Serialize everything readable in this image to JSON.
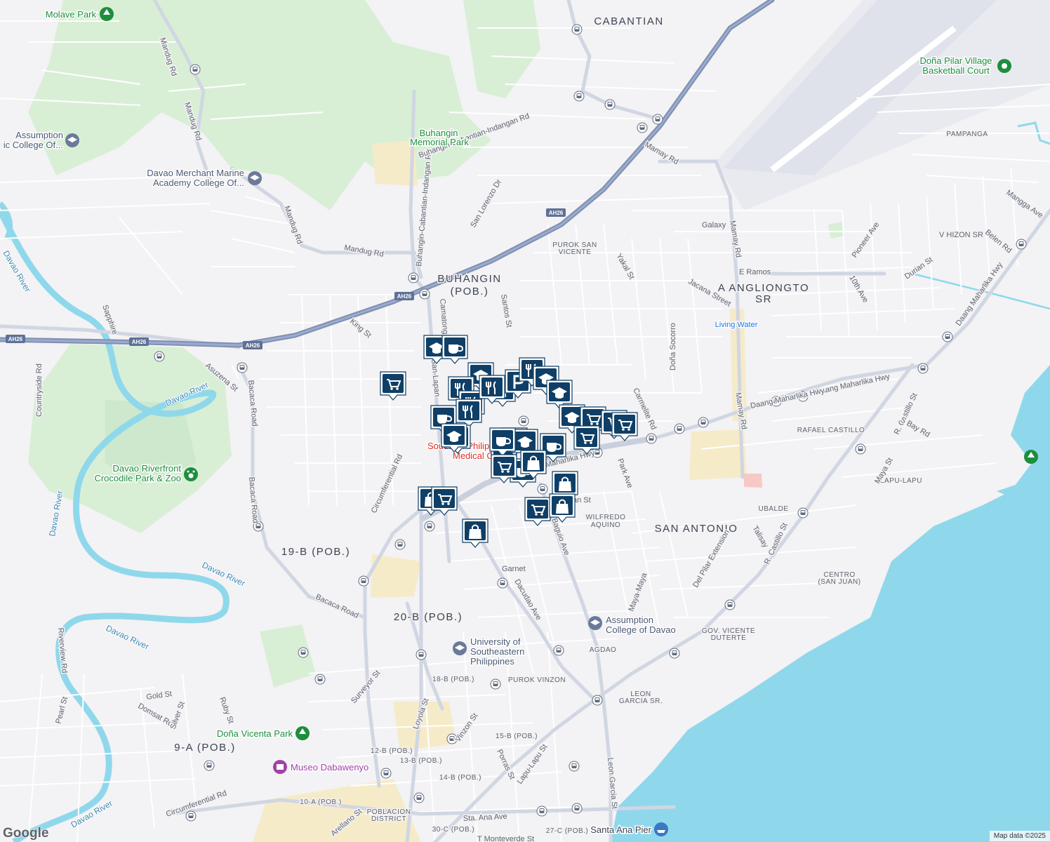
{
  "map": {
    "areas": [
      {
        "id": "cabantian",
        "text": "CABANTIAN"
      },
      {
        "id": "buhangin1",
        "text": "BUHANGIN"
      },
      {
        "id": "buhangin2",
        "text": "(POB.)"
      },
      {
        "id": "anglio1",
        "text": "A ANGLIONGTO"
      },
      {
        "id": "anglio2",
        "text": "SR"
      },
      {
        "id": "sanantonio",
        "text": "SAN ANTONIO"
      },
      {
        "id": "b19",
        "text": "19-B (POB.)"
      },
      {
        "id": "b20",
        "text": "20-B (POB.)"
      },
      {
        "id": "a9",
        "text": "9-A (POB.)"
      }
    ],
    "subareas": [
      {
        "id": "pampanga",
        "text": "PAMPANGA"
      },
      {
        "id": "sanvic1",
        "text": "PUROK SAN"
      },
      {
        "id": "sanvic2",
        "text": "VICENTE"
      },
      {
        "id": "rcastillo",
        "text": "RAFAEL CASTILLO"
      },
      {
        "id": "lapulapu",
        "text": "LAPU-LAPU"
      },
      {
        "id": "ubalde",
        "text": "UBALDE"
      },
      {
        "id": "wilf1",
        "text": "WILFREDO"
      },
      {
        "id": "wilf2",
        "text": "AQUINO"
      },
      {
        "id": "centro1",
        "text": "CENTRO"
      },
      {
        "id": "centro2",
        "text": "(SAN JUAN)"
      },
      {
        "id": "gov1",
        "text": "GOV. VICENTE"
      },
      {
        "id": "gov2",
        "text": "DUTERTE"
      },
      {
        "id": "agdao",
        "text": "AGDAO"
      },
      {
        "id": "purokv",
        "text": "PUROK VINZON"
      },
      {
        "id": "b18",
        "text": "18-B (POB.)"
      },
      {
        "id": "b15",
        "text": "15-B (POB.)"
      },
      {
        "id": "b12",
        "text": "12-B (POB.)"
      },
      {
        "id": "b13",
        "text": "13-B (POB.)"
      },
      {
        "id": "b14",
        "text": "14-B (POB.)"
      },
      {
        "id": "a10",
        "text": "10-A (POB.)"
      },
      {
        "id": "pob1",
        "text": "POBLACION"
      },
      {
        "id": "pob2",
        "text": "DISTRICT"
      },
      {
        "id": "c27",
        "text": "27-C (POB.)"
      },
      {
        "id": "c30",
        "text": "30-C (POB.)"
      },
      {
        "id": "leon1",
        "text": "LEON"
      },
      {
        "id": "leon2",
        "text": "GARCIA SR."
      }
    ],
    "streets": [
      {
        "id": "mandug1",
        "text": "Mandug Rd"
      },
      {
        "id": "mandug2",
        "text": "Mandug Rd"
      },
      {
        "id": "mandug3",
        "text": "Mandug Rd"
      },
      {
        "id": "mandug4",
        "text": "Mandug Rd"
      },
      {
        "id": "bci",
        "text": "Buhangin-Cabantian-Indangan Rd"
      },
      {
        "id": "bci2",
        "text": "Buhangin-Cabantian-Indangan Rd"
      },
      {
        "id": "sanlorenzo",
        "text": "San Lorenzo Dr"
      },
      {
        "id": "mamay",
        "text": "Mamay Rd"
      },
      {
        "id": "mamay2",
        "text": "Mamay Rd"
      },
      {
        "id": "mamay3",
        "text": "Mamay Rd"
      },
      {
        "id": "galaxy",
        "text": "Galaxy"
      },
      {
        "id": "eramos",
        "text": "E Ramos"
      },
      {
        "id": "jacana",
        "text": "Jacana Street"
      },
      {
        "id": "yakal",
        "text": "Yakal St"
      },
      {
        "id": "pioneer",
        "text": "Pioneer Ave"
      },
      {
        "id": "tenth",
        "text": "10th Ave"
      },
      {
        "id": "durian",
        "text": "Durian St"
      },
      {
        "id": "vhizon",
        "text": "V HIZON SR"
      },
      {
        "id": "belen",
        "text": "Belen Rd"
      },
      {
        "id": "mangga",
        "text": "Mangga Ave"
      },
      {
        "id": "dmh",
        "text": "Daang Maharlika Hwy"
      },
      {
        "id": "dmh2",
        "text": "Daang Maharlika Hwy"
      },
      {
        "id": "dmh3",
        "text": "Daang Maharlika Hwy"
      },
      {
        "id": "dmh4",
        "text": "Maharlika Hwy"
      },
      {
        "id": "donasocorro",
        "text": "Doña Socorro"
      },
      {
        "id": "carmelite",
        "text": "Carmelite Rd"
      },
      {
        "id": "rcastillost",
        "text": "R. Castillo St"
      },
      {
        "id": "rcastillost2",
        "text": "R. Castillo St"
      },
      {
        "id": "sbay",
        "text": "S Bay Rd"
      },
      {
        "id": "maya",
        "text": "Maya St"
      },
      {
        "id": "parkave",
        "text": "Park Ave"
      },
      {
        "id": "talisay",
        "text": "Talisay"
      },
      {
        "id": "delpilar",
        "text": "Del Pilar Extension"
      },
      {
        "id": "mayamaya",
        "text": "Maya-Maya"
      },
      {
        "id": "baguio",
        "text": "Baguio Ave"
      },
      {
        "id": "dacudao",
        "text": "Dacudao Ave"
      },
      {
        "id": "garnet",
        "text": "Garnet"
      },
      {
        "id": "santos",
        "text": "Santos St"
      },
      {
        "id": "camatong",
        "text": "Camatong"
      },
      {
        "id": "sanlapan",
        "text": "San-Lapan"
      },
      {
        "id": "circ1",
        "text": "Circumferential Rd"
      },
      {
        "id": "circ2",
        "text": "Circumferential Rd"
      },
      {
        "id": "king",
        "text": "King St"
      },
      {
        "id": "asuzena",
        "text": "Asuzena St"
      },
      {
        "id": "bacaca1",
        "text": "Bacaca Road"
      },
      {
        "id": "bacaca2",
        "text": "Bacaca Road"
      },
      {
        "id": "bacaca3",
        "text": "Bacaca Road"
      },
      {
        "id": "sapphire",
        "text": "Sapphire"
      },
      {
        "id": "countryside",
        "text": "Countryside Rd"
      },
      {
        "id": "riverview",
        "text": "Riverview Rd"
      },
      {
        "id": "pearl",
        "text": "Pearl St"
      },
      {
        "id": "goldst",
        "text": "Gold St"
      },
      {
        "id": "domsat",
        "text": "Domsat Rd"
      },
      {
        "id": "silver",
        "text": "Silver St"
      },
      {
        "id": "ruby",
        "text": "Ruby St"
      },
      {
        "id": "surveyor",
        "text": "Surveyor St"
      },
      {
        "id": "loyola",
        "text": "Loyola St"
      },
      {
        "id": "vinzon",
        "text": "Vinzon St"
      },
      {
        "id": "porras",
        "text": "Porras St"
      },
      {
        "id": "lapulapust",
        "text": "Lapu-Lapu St"
      },
      {
        "id": "leongarcia",
        "text": "Leon Garcia St"
      },
      {
        "id": "staana",
        "text": "Sta. Ana Ave"
      },
      {
        "id": "arellano",
        "text": "Arellano St"
      },
      {
        "id": "tmonteverde",
        "text": "T Monteverde St"
      },
      {
        "id": "yan",
        "text": "an St"
      }
    ],
    "rivers": [
      {
        "id": "r1",
        "text": "Davao River"
      },
      {
        "id": "r2",
        "text": "Davao River"
      },
      {
        "id": "r3",
        "text": "Davao River"
      },
      {
        "id": "r4",
        "text": "Davao River"
      },
      {
        "id": "r5",
        "text": "Davao River"
      },
      {
        "id": "r6",
        "text": "Davao River"
      }
    ],
    "pois": [
      {
        "id": "molave",
        "text": "Molave Park",
        "color": "#1e8e3e"
      },
      {
        "id": "assumption1",
        "text": "Assumption",
        "color": "#4a5a74"
      },
      {
        "id": "assumption2",
        "text": "ic College Of...",
        "color": "#4a5a74"
      },
      {
        "id": "merchant1",
        "text": "Davao Merchant Marine",
        "color": "#4a5a74"
      },
      {
        "id": "merchant2",
        "text": "Academy College Of...",
        "color": "#4a5a74"
      },
      {
        "id": "buhanginpark1",
        "text": "Buhangin",
        "color": "#1e8e3e"
      },
      {
        "id": "buhanginpark2",
        "text": "Memorial Park",
        "color": "#1e8e3e"
      },
      {
        "id": "dona1",
        "text": "Doña Pilar Village",
        "color": "#1e8e3e"
      },
      {
        "id": "dona2",
        "text": "Basketball Court",
        "color": "#1e8e3e"
      },
      {
        "id": "croc1",
        "text": "Davao Riverfront",
        "color": "#1e8e3e"
      },
      {
        "id": "croc2",
        "text": "Crocodile Park & Zoo",
        "color": "#1e8e3e"
      },
      {
        "id": "livingwater",
        "text": "Living Water",
        "color": "#1a73e8"
      },
      {
        "id": "medic1",
        "text": "Southern Philippines",
        "color": "#d93025"
      },
      {
        "id": "medic2",
        "text": "Medical Center",
        "color": "#d93025"
      },
      {
        "id": "acd1",
        "text": "Assumption",
        "color": "#4a5a74"
      },
      {
        "id": "acd2",
        "text": "College of Davao",
        "color": "#4a5a74"
      },
      {
        "id": "usp1",
        "text": "University of",
        "color": "#4a5a74"
      },
      {
        "id": "usp2",
        "text": "Southeastern",
        "color": "#4a5a74"
      },
      {
        "id": "usp3",
        "text": "Philippines",
        "color": "#4a5a74"
      },
      {
        "id": "vicenta",
        "text": "Doña Vicenta Park",
        "color": "#1e8e3e"
      },
      {
        "id": "museo",
        "text": "Museo Dabawenyo",
        "color": "#a142a8"
      },
      {
        "id": "pier",
        "text": "Santa Ana Pier",
        "color": "#3d4452"
      }
    ],
    "highway_shields": [
      {
        "id": "s1",
        "text": "AH26"
      },
      {
        "id": "s2",
        "text": "AH26"
      },
      {
        "id": "s3",
        "text": "AH26"
      },
      {
        "id": "s4",
        "text": "AH26"
      },
      {
        "id": "s5",
        "text": "AH26"
      }
    ],
    "markers": [
      {
        "kind": "shopping-cart"
      },
      {
        "kind": "graduation-cap"
      },
      {
        "kind": "coffee-cup"
      },
      {
        "kind": "graduation-cap"
      },
      {
        "kind": "fork-knife"
      },
      {
        "kind": "fork-knife"
      },
      {
        "kind": "fork-knife"
      },
      {
        "kind": "fork-knife"
      },
      {
        "kind": "parking"
      },
      {
        "kind": "fork-knife"
      },
      {
        "kind": "graduation-cap"
      },
      {
        "kind": "graduation-cap"
      },
      {
        "kind": "coffee-cup"
      },
      {
        "kind": "fork-knife"
      },
      {
        "kind": "graduation-cap"
      },
      {
        "kind": "graduation-cap"
      },
      {
        "kind": "graduation-cap"
      },
      {
        "kind": "shopping-cart"
      },
      {
        "kind": "shopping-cart"
      },
      {
        "kind": "shopping-cart"
      },
      {
        "kind": "shopping-cart"
      },
      {
        "kind": "shopping-cart"
      },
      {
        "kind": "coffee-cup"
      },
      {
        "kind": "graduation-cap"
      },
      {
        "kind": "coffee-cup"
      },
      {
        "kind": "shopping-bag"
      },
      {
        "kind": "coffee-cup"
      },
      {
        "kind": "shopping-cart"
      },
      {
        "kind": "coffee-cup"
      },
      {
        "kind": "shopping-bag"
      },
      {
        "kind": "shopping-cart"
      },
      {
        "kind": "shopping-bag"
      },
      {
        "kind": "shopping-bag"
      },
      {
        "kind": "shopping-cart"
      },
      {
        "kind": "shopping-bag"
      }
    ],
    "colors": {
      "land": "#f3f2f4",
      "water": "#8fd8ec",
      "park": "#d9f0d9",
      "road": "#ffffff",
      "highway": "#8a9bbd",
      "marker": "#0f3f66",
      "built": "#f6ebc8"
    }
  },
  "footer": {
    "logo": "Google",
    "credit": "Map data ©2025"
  }
}
